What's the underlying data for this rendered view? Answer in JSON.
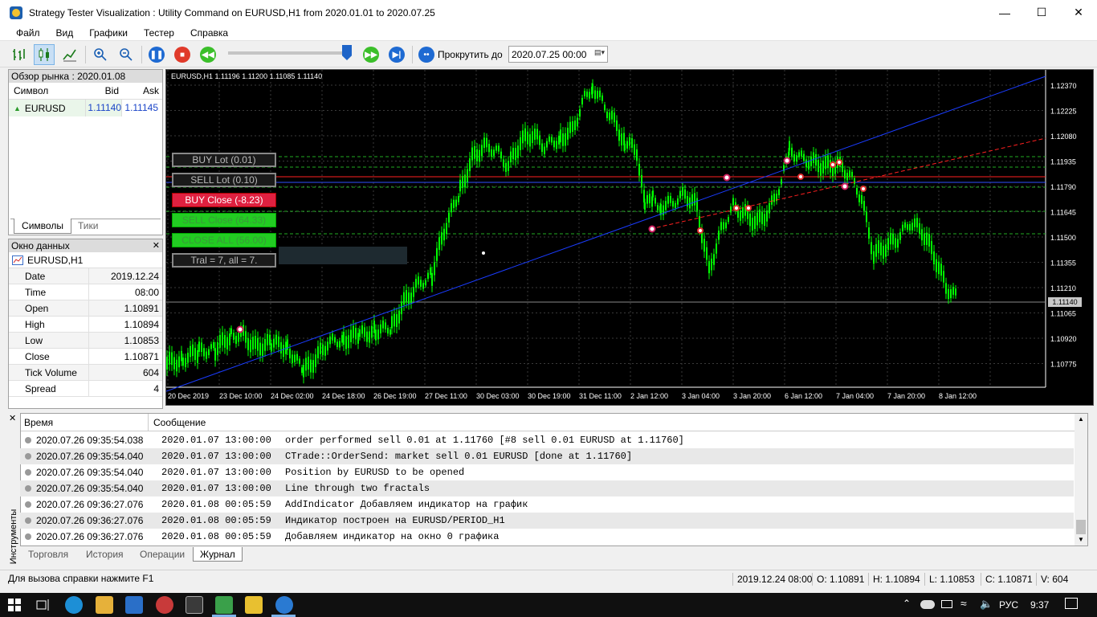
{
  "window": {
    "title": "Strategy Tester Visualization : Utility Command on EURUSD,H1 from 2020.01.01 to 2020.07.25"
  },
  "menu": [
    "Файл",
    "Вид",
    "Графики",
    "Тестер",
    "Справка"
  ],
  "toolbar": {
    "scroll_label": "Прокрутить до",
    "scroll_date": "2020.07.25 00:00"
  },
  "market_watch": {
    "title": "Обзор рынка : 2020.01.08",
    "columns": [
      "Символ",
      "Bid",
      "Ask"
    ],
    "rows": [
      {
        "symbol": "EURUSD",
        "bid": "1.11140",
        "ask": "1.11145"
      }
    ],
    "tabs": [
      "Символы",
      "Тики"
    ]
  },
  "data_window": {
    "title": "Окно данных",
    "symbol": "EURUSD,H1",
    "rows": [
      {
        "k": "Date",
        "v": "2019.12.24"
      },
      {
        "k": "Time",
        "v": "08:00"
      },
      {
        "k": "Open",
        "v": "1.10891"
      },
      {
        "k": "High",
        "v": "1.10894"
      },
      {
        "k": "Low",
        "v": "1.10853"
      },
      {
        "k": "Close",
        "v": "1.10871"
      },
      {
        "k": "Tick Volume",
        "v": "604"
      },
      {
        "k": "Spread",
        "v": "4"
      }
    ]
  },
  "chart": {
    "header": "EURUSD,H1  1.11196 1.11200 1.11085 1.11140",
    "current_price": "1.11140",
    "price_labels": [
      "1.12370",
      "1.12225",
      "1.12080",
      "1.11935",
      "1.11790",
      "1.11645",
      "1.11500",
      "1.11355",
      "1.11210",
      "1.11065",
      "1.10920",
      "1.10775"
    ],
    "time_labels": [
      "20 Dec 2019",
      "23 Dec 10:00",
      "24 Dec 02:00",
      "24 Dec 18:00",
      "26 Dec 19:00",
      "27 Dec 11:00",
      "30 Dec 03:00",
      "30 Dec 19:00",
      "31 Dec 11:00",
      "2 Jan 12:00",
      "3 Jan 04:00",
      "3 Jan 20:00",
      "6 Jan 12:00",
      "7 Jan 04:00",
      "7 Jan 20:00",
      "8 Jan 12:00"
    ],
    "panel_buttons": {
      "buy_lot": "BUY Lot (0.01)",
      "sell_lot": "SELL Lot (0.10)",
      "buy_close": "BUY Close (-8.23)",
      "sell_close": "SELL Close (64.33)",
      "close_all": "CLOSE ALL (56.00)",
      "tral": "Tral = 7, all = 7."
    },
    "colors": {
      "bg": "#000000",
      "candle": "#00ff00",
      "grid": "#3a3a3a",
      "blue_line": "#1a3cff",
      "red_line": "#ff2020"
    }
  },
  "journal": {
    "side_label": "Инструменты",
    "columns": [
      "Время",
      "Сообщение"
    ],
    "rows": [
      {
        "time": "2020.07.26 09:35:54.038",
        "date": "2020.01.07 13:00:00",
        "msg": "order performed sell 0.01 at 1.11760 [#8 sell 0.01 EURUSD at 1.11760]"
      },
      {
        "time": "2020.07.26 09:35:54.040",
        "date": "2020.01.07 13:00:00",
        "msg": "CTrade::OrderSend: market sell 0.01 EURUSD [done at 1.11760]"
      },
      {
        "time": "2020.07.26 09:35:54.040",
        "date": "2020.01.07 13:00:00",
        "msg": "Position by EURUSD to be opened"
      },
      {
        "time": "2020.07.26 09:35:54.040",
        "date": "2020.01.07 13:00:00",
        "msg": "Line through two fractals"
      },
      {
        "time": "2020.07.26 09:36:27.076",
        "date": "2020.01.08 00:05:59",
        "msg": "AddIndicator  Добавляем индикатор на график"
      },
      {
        "time": "2020.07.26 09:36:27.076",
        "date": "2020.01.08 00:05:59",
        "msg": "Индикатор построен на EURUSD/PERIOD_H1"
      },
      {
        "time": "2020.07.26 09:36:27.076",
        "date": "2020.01.08 00:05:59",
        "msg": "Добавляем индикатор на окно 0 графика"
      }
    ],
    "tabs": [
      "Торговля",
      "История",
      "Операции",
      "Журнал"
    ]
  },
  "statusbar": {
    "help": "Для вызова справки нажмите F1",
    "datetime": "2019.12.24 08:00",
    "open": "O: 1.10891",
    "high": "H: 1.10894",
    "low": "L: 1.10853",
    "close": "C: 1.10871",
    "volume": "V: 604"
  },
  "taskbar": {
    "lang": "РУС",
    "time": "9:37"
  }
}
